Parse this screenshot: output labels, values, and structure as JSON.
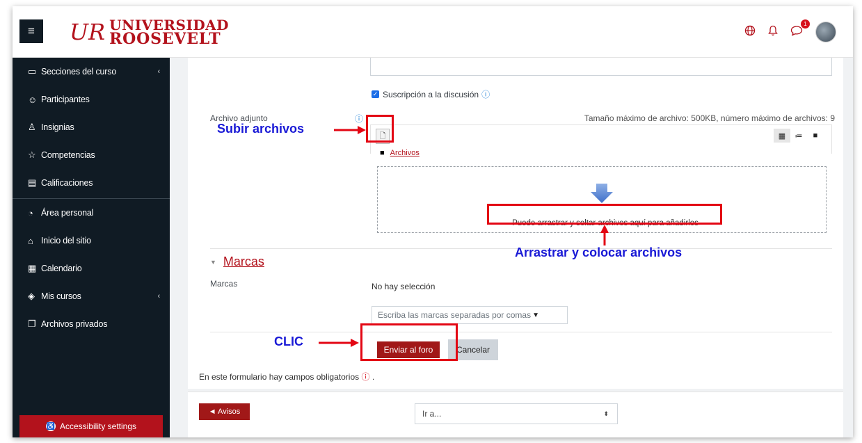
{
  "brand": {
    "name_line1": "UNIVERSIDAD",
    "name_line2": "ROOSEVELT",
    "mark": "UR"
  },
  "navbar": {
    "menu_icon": "hamburger-icon",
    "icons": [
      "globe-icon",
      "bell-icon",
      "chat-icon"
    ],
    "notification_count": "1"
  },
  "sidebar": {
    "items": [
      {
        "label": "Secciones del curso",
        "icon": "folder-icon",
        "chevron": "‹"
      },
      {
        "label": "Participantes",
        "icon": "users-icon"
      },
      {
        "label": "Insignias",
        "icon": "badge-icon"
      },
      {
        "label": "Competencias",
        "icon": "star-icon"
      },
      {
        "label": "Calificaciones",
        "icon": "gradebook-icon"
      },
      {
        "label": "Área personal",
        "icon": "dashboard-icon"
      },
      {
        "label": "Inicio del sitio",
        "icon": "home-icon"
      },
      {
        "label": "Calendario",
        "icon": "calendar-icon"
      },
      {
        "label": "Mis cursos",
        "icon": "graduation-cap-icon",
        "chevron": "‹"
      },
      {
        "label": "Archivos privados",
        "icon": "files-icon"
      }
    ],
    "accessibility_label": "Accessibility settings"
  },
  "form": {
    "subscription_label": "Suscripción a la discusión",
    "attachment_label": "Archivo adjunto",
    "max_size_text": "Tamaño máximo de archivo: 500KB, número máximo de archivos: 9",
    "folder_link": "Archivos",
    "drop_text": "Puede arrastrar y soltar archivos aquí para añadirlos",
    "tags_section_title": "Marcas",
    "tags_label": "Marcas",
    "tags_none": "No hay selección",
    "tags_placeholder": "Escriba las marcas separadas por comas",
    "submit_label": "Enviar al foro",
    "cancel_label": "Cancelar",
    "required_note": "En este formulario hay campos obligatorios",
    "required_suffix": "."
  },
  "footer_nav": {
    "prev_label": "◄ Avisos",
    "jump_label": "Ir a..."
  },
  "annotations": {
    "upload": "Subir archivos",
    "drag_drop": "Arrastrar y colocar archivos",
    "click": "CLIC"
  },
  "colors": {
    "brand_red": "#b3121c",
    "sidebar_bg": "#101b24",
    "annotation_blue": "#1a1ad6",
    "annotation_red": "#e30613"
  }
}
